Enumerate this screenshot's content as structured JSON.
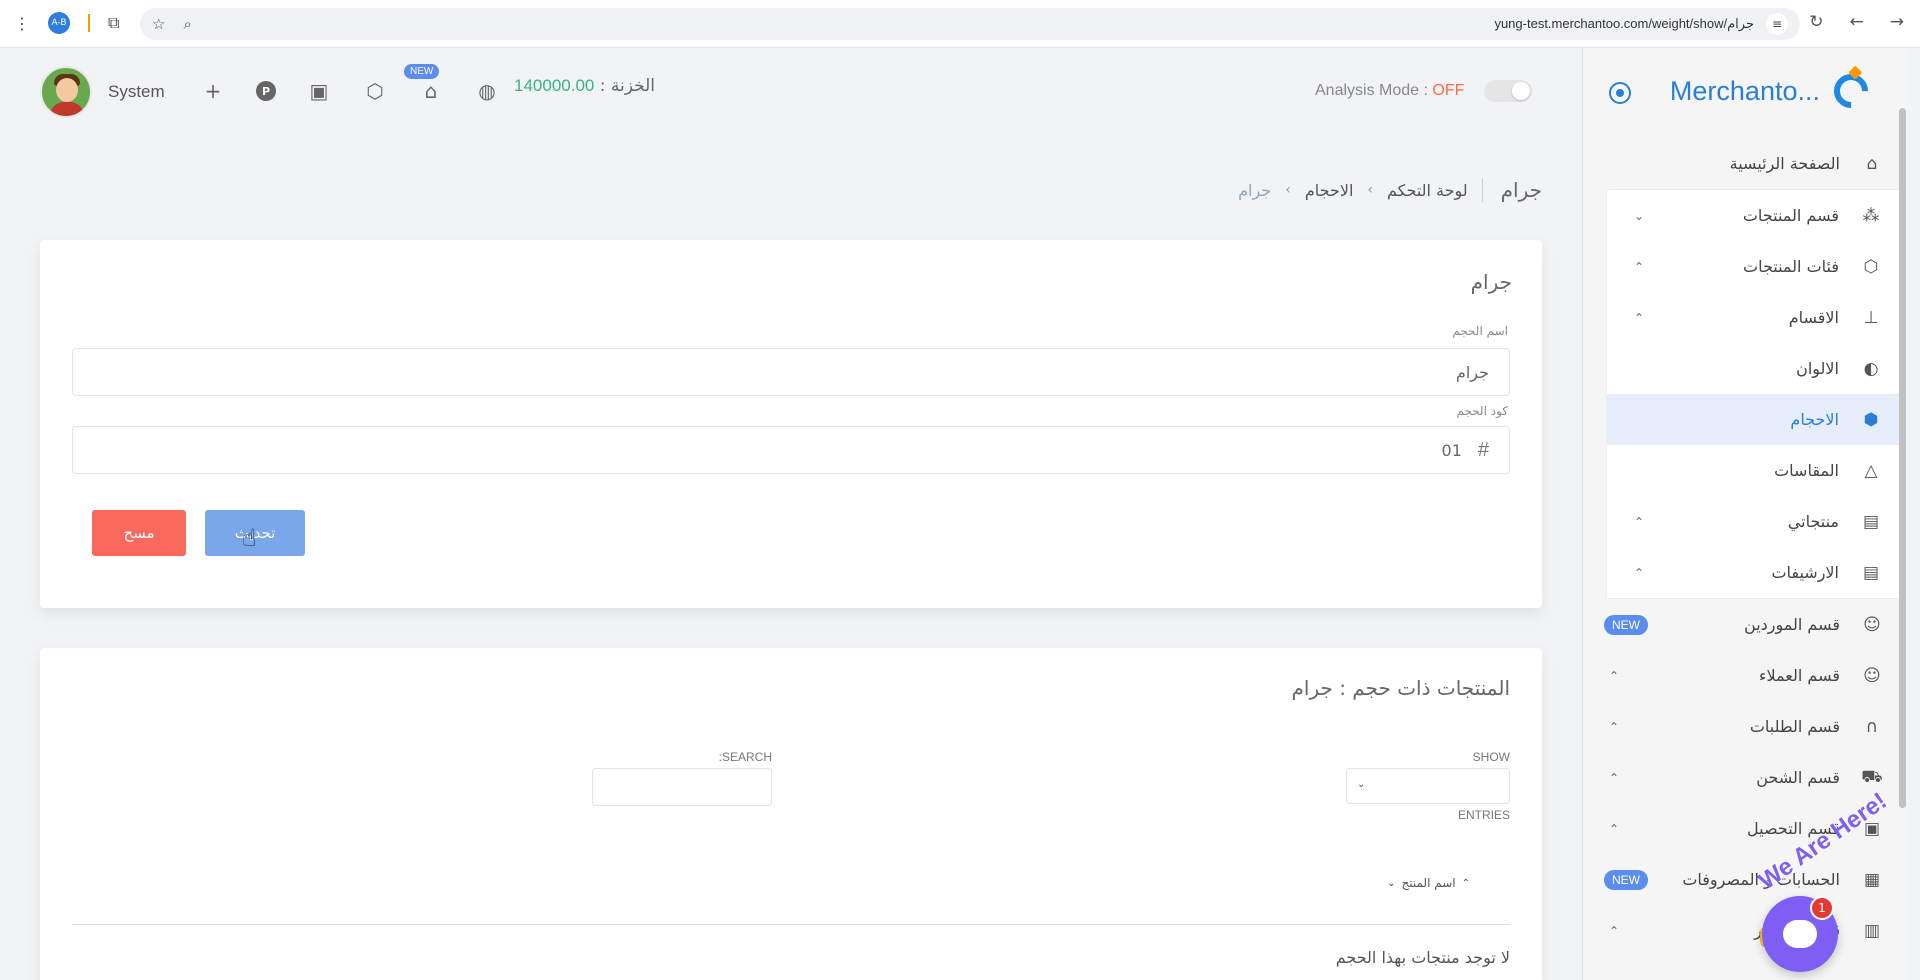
{
  "browser": {
    "url": "yung-test.merchantoo.com/weight/show/جرام",
    "ext_label": "A-B"
  },
  "topbar": {
    "user_name": "System",
    "new_badge": "NEW",
    "treasury_label": "الخزنة :",
    "treasury_amount": "140000.00",
    "analysis_label": "Analysis Mode :",
    "analysis_state": "OFF"
  },
  "sidebar": {
    "brand": "Merchanto...",
    "items": [
      {
        "label": "الصفحة الرئيسية",
        "icon": "home-icon"
      },
      {
        "label": "قسم المنتجات",
        "icon": "products-icon"
      },
      {
        "label": "فئات المنتجات",
        "icon": "box-icon"
      },
      {
        "label": "الاقسام",
        "icon": "sitemap-icon"
      },
      {
        "label": "الالوان",
        "icon": "palette-icon"
      },
      {
        "label": "الاحجام",
        "icon": "cube-icon"
      },
      {
        "label": "المقاسات",
        "icon": "hanger-icon"
      },
      {
        "label": "منتجاتي",
        "icon": "archive-icon"
      },
      {
        "label": "الارشيفات",
        "icon": "archive-icon"
      },
      {
        "label": "قسم الموردين",
        "icon": "user-icon",
        "badge": "NEW"
      },
      {
        "label": "قسم العملاء",
        "icon": "user-icon"
      },
      {
        "label": "قسم الطلبات",
        "icon": "headset-icon"
      },
      {
        "label": "قسم الشحن",
        "icon": "truck-icon"
      },
      {
        "label": "قسم التحصيل",
        "icon": "cash-icon"
      },
      {
        "label": "الحسابات و المصروفات",
        "icon": "wallet-icon",
        "badge": "NEW"
      },
      {
        "label": "قسم التقارير",
        "icon": "report-icon"
      }
    ]
  },
  "breadcrumb": {
    "title": "جرام",
    "items": [
      "لوحة التحكم",
      "الاحجام",
      "جرام"
    ]
  },
  "form": {
    "title": "جرام",
    "name_label": "اسم الحجم",
    "name_value": "جرام",
    "code_label": "كود الحجم",
    "code_value": "01",
    "update_label": "تحديث",
    "delete_label": "مسح"
  },
  "products": {
    "title": "المنتجات ذات حجم : جرام",
    "show_label": "SHOW",
    "entries_label": "ENTRIES",
    "search_label": "SEARCH:",
    "column_header": "اسم المنتج",
    "empty_text": "لا توجد منتجات بهذا الحجم"
  },
  "chat": {
    "greeting": "We Are Here!",
    "unread": "1"
  },
  "colors": {
    "accent": "#2a7fd4",
    "update_button": "#7aa7ea",
    "delete_button": "#fa6a5c",
    "treasury": "#3ab286",
    "off": "#ff6b4a",
    "chat": "#7e5ef3"
  }
}
